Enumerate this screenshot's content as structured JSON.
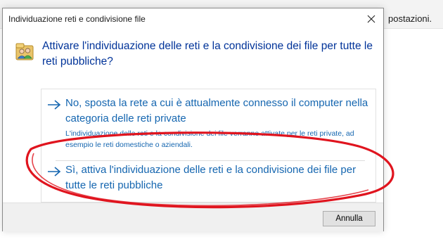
{
  "background": {
    "partial_text": "postazioni."
  },
  "dialog": {
    "title": "Individuazione reti e condivisione file",
    "close_icon": "close-icon",
    "question": "Attivare l'individuazione delle reti e la condivisione dei file per tutte le reti pubbliche?",
    "options": [
      {
        "title": "No, sposta la rete a cui è attualmente connesso il computer nella categoria delle reti private",
        "description": "L'individuazione delle reti e la condivisione dei file verranno attivate per le reti private, ad esempio le reti domestiche o aziendali."
      },
      {
        "title": "Sì, attiva l'individuazione delle reti e la condivisione dei file per tutte le reti pubbliche"
      }
    ],
    "cancel_label": "Annulla"
  },
  "colors": {
    "link_blue": "#1566b0",
    "heading_blue": "#003399",
    "annotation_red": "#e0141e"
  }
}
